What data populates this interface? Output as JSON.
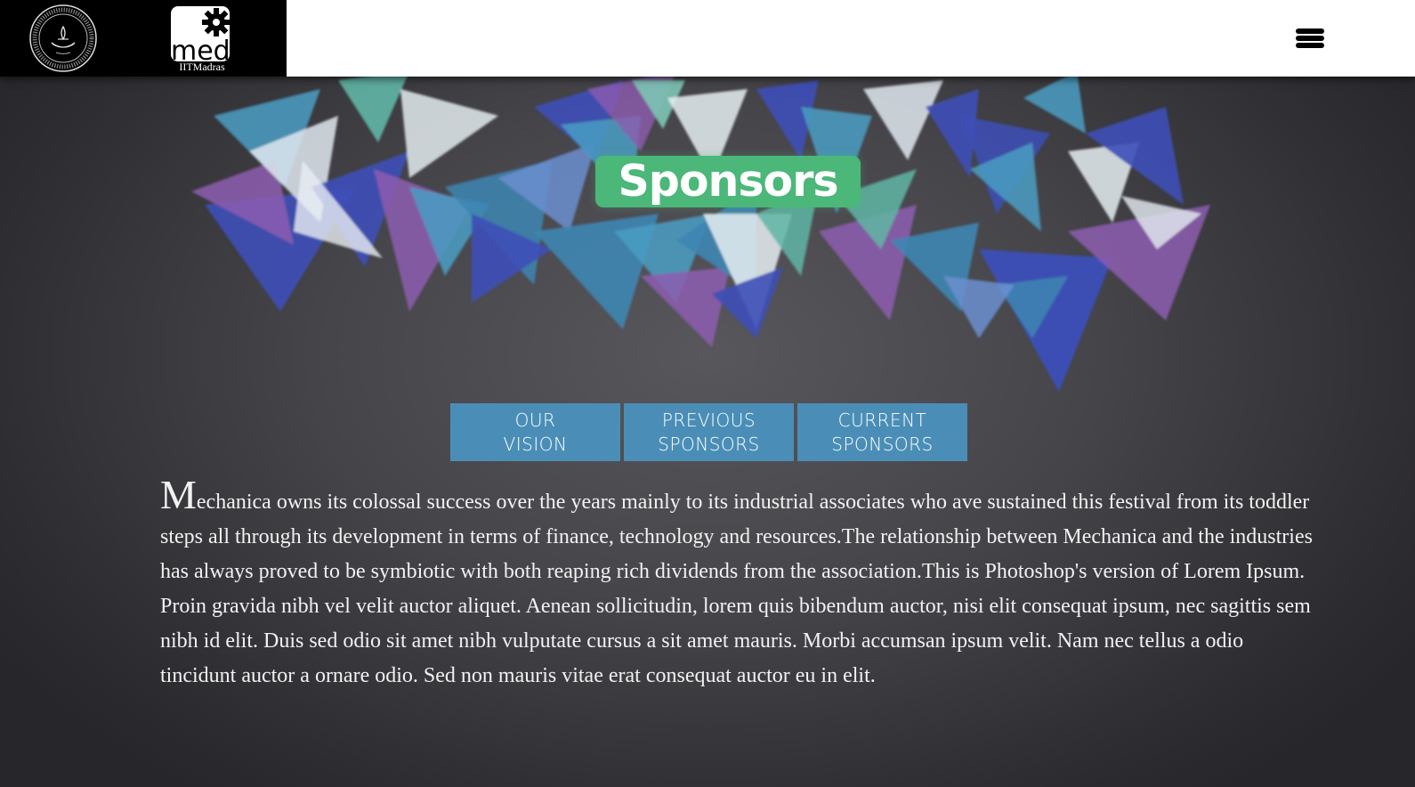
{
  "header": {
    "med_logo_text": "med",
    "med_logo_caption": "IITMadras",
    "menu_icon": "hamburger-menu-icon"
  },
  "hero": {
    "title": "Sponsors",
    "title_bg_color": "#4bb779"
  },
  "tabs": [
    {
      "line1": "Our",
      "line2": "Vision"
    },
    {
      "line1": "Previous",
      "line2": "Sponsors"
    },
    {
      "line1": "Current",
      "line2": "Sponsors"
    }
  ],
  "tab_color": "#4a8eb7",
  "content": {
    "drop_cap": "M",
    "paragraph": "echanica owns its colossal success over the years mainly to its industrial associates who ave sustained this festival from its toddler steps all through its development in terms of finance, technology and resources.The relationship between Mechanica and the industries has always proved to be symbiotic with both reaping rich dividends from the association.This is Photoshop's version  of Lorem Ipsum. Proin gravida nibh vel velit auctor aliquet. Aenean sollicitudin, lorem quis bibendum auctor, nisi elit consequat ipsum, nec sagittis sem nibh id elit. Duis sed odio sit amet nibh vulputate cursus a sit amet mauris. Morbi accumsan ipsum velit. Nam nec tellus a odio tincidunt auctor a ornare odio. Sed non  mauris vitae erat consequat auctor eu in elit."
  }
}
